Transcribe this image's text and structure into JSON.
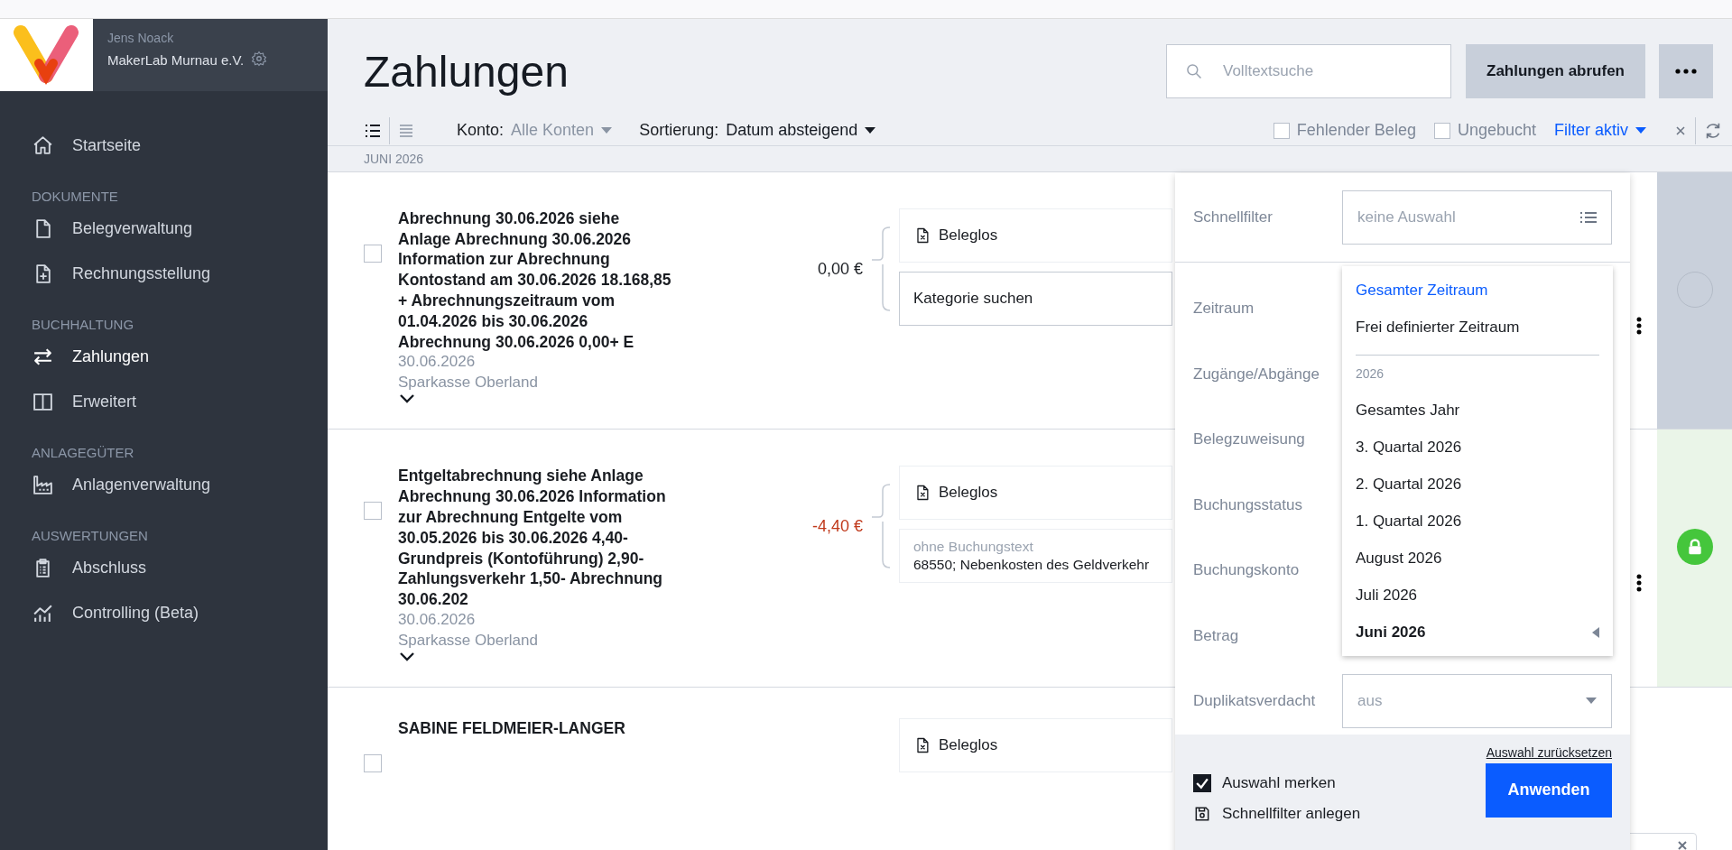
{
  "sidebar": {
    "user": "Jens Noack",
    "organization": "MakerLab Murnau e.V.",
    "nav": [
      {
        "kind": "item",
        "label": "Startseite",
        "selected": false
      },
      {
        "kind": "heading",
        "label": "DOKUMENTE"
      },
      {
        "kind": "item",
        "label": "Belegverwaltung",
        "selected": false
      },
      {
        "kind": "item",
        "label": "Rechnungsstellung",
        "selected": false
      },
      {
        "kind": "heading",
        "label": "BUCHHALTUNG"
      },
      {
        "kind": "item",
        "label": "Zahlungen",
        "selected": true
      },
      {
        "kind": "item",
        "label": "Erweitert",
        "selected": false
      },
      {
        "kind": "heading",
        "label": "ANLAGEGÜTER"
      },
      {
        "kind": "item",
        "label": "Anlagenverwaltung",
        "selected": false
      },
      {
        "kind": "heading",
        "label": "AUSWERTUNGEN"
      },
      {
        "kind": "item",
        "label": "Abschluss",
        "selected": false
      },
      {
        "kind": "item",
        "label": "Controlling (Beta)",
        "selected": false
      }
    ]
  },
  "header": {
    "title": "Zahlungen",
    "search": {
      "placeholder": "Volltextsuche"
    },
    "fetch_button": "Zahlungen abrufen"
  },
  "toolbar": {
    "views": [
      {
        "selected": true
      },
      {
        "selected": false
      }
    ],
    "account": {
      "label": "Konto:",
      "value": "Alle Konten"
    },
    "sort": {
      "label": "Sortierung:",
      "value": "Datum absteigend"
    },
    "checkboxes": [
      {
        "label": "Fehlender Beleg",
        "checked": false
      },
      {
        "label": "Ungebucht",
        "checked": false
      }
    ],
    "filter_link": "Filter aktiv"
  },
  "group_header": "JUNI 2026",
  "rows": [
    {
      "checked": false,
      "title": "Abrechnung 30.06.2026 siehe Anlage Abrechnung 30.06.2026 Information zur Abrechnung Kontostand am 30.06.2026 18.168,85 + Abrechnungszeitraum vom 01.04.2026 bis 30.06.2026 Abrechnung 30.06.2026 0,00+ E",
      "date": "30.06.2026",
      "bank": "Sparkasse Oberland",
      "amount": "0,00 €",
      "negative": false,
      "kind": "pending",
      "cards": [
        {
          "kind": "receipt",
          "label": "Beleglos"
        },
        {
          "kind": "category",
          "placeholder": "Kategorie suchen"
        }
      ]
    },
    {
      "checked": false,
      "title": "Entgeltabrechnung siehe Anlage Abrechnung 30.06.2026 Information zur Abrechnung Entgelte vom 30.05.2026 bis 30.06.2026 4,40- Grundpreis (Kontoführung) 2,90- Zahlungsverkehr 1,50- Abrechnung 30.06.202",
      "date": "30.06.2026",
      "bank": "Sparkasse Oberland",
      "amount": "-4,40 €",
      "negative": true,
      "kind": "locked",
      "cards": [
        {
          "kind": "receipt",
          "label": "Beleglos"
        },
        {
          "kind": "booking",
          "placeholder": "ohne Buchungstext",
          "value": "68550; Nebenkosten des Geldverkehr"
        }
      ]
    },
    {
      "checked": false,
      "title": "SABINE FELDMEIER-LANGER",
      "kind": "plain",
      "cards": [
        {
          "kind": "receipt",
          "label": "Beleglos"
        }
      ]
    }
  ],
  "filter_panel": {
    "quick_filter": {
      "label": "Schnellfilter",
      "placeholder": "keine Auswahl"
    },
    "fields": [
      {
        "label": "Zeitraum"
      },
      {
        "label": "Zugänge/Abgänge"
      },
      {
        "label": "Belegzuweisung"
      },
      {
        "label": "Buchungsstatus"
      },
      {
        "label": "Buchungskonto"
      },
      {
        "label": "Betrag"
      },
      {
        "label": "Duplikatsverdacht",
        "value": "aus"
      }
    ],
    "dropdown": [
      {
        "kind": "option",
        "label": "Gesamter Zeitraum",
        "selected": true,
        "current": false
      },
      {
        "kind": "option",
        "label": "Frei definierter Zeitraum",
        "selected": false,
        "current": false
      },
      {
        "kind": "group",
        "label": "2026"
      },
      {
        "kind": "option",
        "label": "Gesamtes Jahr",
        "selected": false,
        "current": false
      },
      {
        "kind": "option",
        "label": "3. Quartal 2026",
        "selected": false,
        "current": false
      },
      {
        "kind": "option",
        "label": "2. Quartal 2026",
        "selected": false,
        "current": false
      },
      {
        "kind": "option",
        "label": "1. Quartal 2026",
        "selected": false,
        "current": false
      },
      {
        "kind": "option",
        "label": "August 2026",
        "selected": false,
        "current": false
      },
      {
        "kind": "option",
        "label": "Juli 2026",
        "selected": false,
        "current": false
      },
      {
        "kind": "option",
        "label": "Juni 2026",
        "selected": false,
        "current": true
      }
    ],
    "reset_link": "Auswahl zurücksetzen",
    "remember": {
      "label": "Auswahl merken",
      "checked": true
    },
    "save_quick_filter": "Schnellfilter anlegen",
    "apply_button": "Anwenden"
  }
}
